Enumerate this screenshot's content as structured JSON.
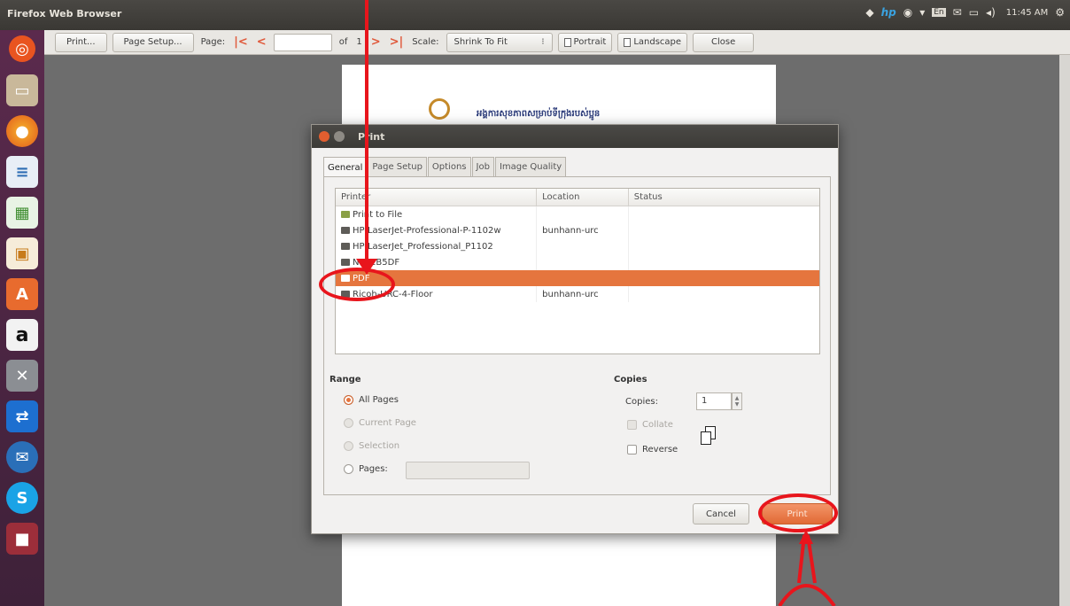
{
  "topbar": {
    "title": "Firefox Web Browser",
    "time": "11:45 AM"
  },
  "launcher": {
    "icons": [
      "ubuntu-dash-icon",
      "files-icon",
      "firefox-icon",
      "writer-icon",
      "calc-icon",
      "impress-icon",
      "software-center-icon",
      "amazon-icon",
      "settings-icon",
      "teamviewer-icon",
      "thunderbird-icon",
      "skype-icon",
      "app-icon"
    ]
  },
  "preview_toolbar": {
    "print_label": "Print...",
    "page_setup_label": "Page Setup...",
    "page_label": "Page:",
    "of_label": "of",
    "total_pages": "1",
    "scale_label": "Scale:",
    "scale_value": "Shrink To Fit",
    "portrait_label": "Portrait",
    "landscape_label": "Landscape",
    "close_label": "Close"
  },
  "sheet": {
    "header_text": "អង្គការសុខភាពសម្រាប់ទីក្រុងរបស់ប្អូន"
  },
  "dialog": {
    "title": "Print",
    "tabs": [
      "General",
      "Page Setup",
      "Options",
      "Job",
      "Image Quality"
    ],
    "columns": [
      "Printer",
      "Location",
      "Status"
    ],
    "printers": [
      {
        "name": "Print to File",
        "location": "",
        "status": ""
      },
      {
        "name": "HP-LaserJet-Professional-P-1102w",
        "location": "bunhann-urc",
        "status": ""
      },
      {
        "name": "HP-LaserJet_Professional_P1102",
        "location": "",
        "status": ""
      },
      {
        "name": "NPI-1B5DF",
        "location": "",
        "status": ""
      },
      {
        "name": "PDF",
        "location": "",
        "status": ""
      },
      {
        "name": "Ricoh-URC-4-Floor",
        "location": "bunhann-urc",
        "status": ""
      }
    ],
    "range": {
      "title": "Range",
      "all_pages": "All Pages",
      "current_page": "Current Page",
      "selection": "Selection",
      "pages": "Pages:"
    },
    "copies": {
      "title": "Copies",
      "label": "Copies:",
      "value": "1",
      "collate": "Collate",
      "reverse": "Reverse"
    },
    "cancel_label": "Cancel",
    "print_label": "Print"
  },
  "colors": {
    "accent": "#e5753e",
    "annotation": "#e8151c"
  }
}
